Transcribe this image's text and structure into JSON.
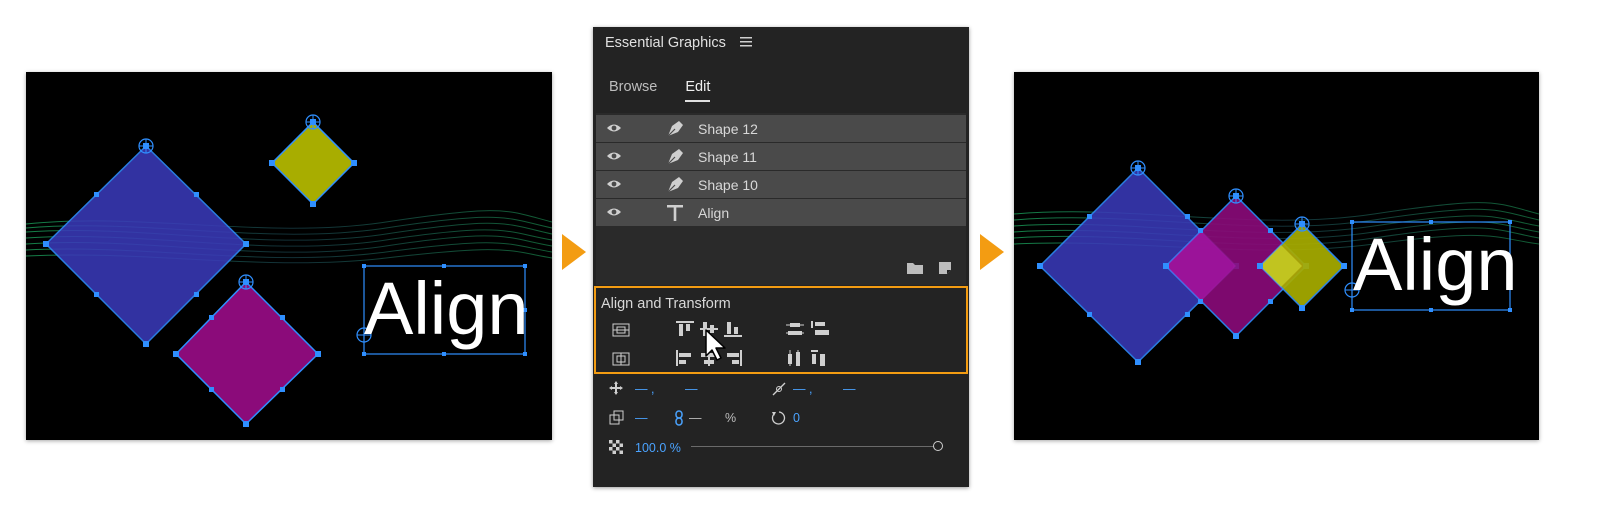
{
  "panel": {
    "title": "Essential Graphics",
    "tabs": [
      {
        "label": "Browse",
        "active": false
      },
      {
        "label": "Edit",
        "active": true
      }
    ],
    "layers": [
      {
        "name": "Shape 12",
        "type": "pen-icon"
      },
      {
        "name": "Shape 11",
        "type": "pen-icon"
      },
      {
        "name": "Shape 10",
        "type": "pen-icon"
      },
      {
        "name": "Align",
        "type": "text-tool-icon"
      }
    ],
    "align_section": {
      "title": "Align and Transform"
    },
    "properties": {
      "position_x": "— ,",
      "position_y": "—",
      "anchor_x": "— ,",
      "anchor_y": "—",
      "scale": "—",
      "scale_linked": "—",
      "percent": "%",
      "rotation": "0",
      "opacity": "100.0 %"
    }
  },
  "canvas_before": {
    "text": "Align"
  },
  "canvas_after": {
    "text": "Align"
  },
  "colors": {
    "highlight": "#f39c12",
    "blue_shape": "#3a3ab8",
    "magenta_shape": "#8b0b7a",
    "olive_shape": "#a8ad00",
    "selection": "#2f8fff",
    "panel_bg": "#232323",
    "layer_row": "#4a4a4a",
    "value_blue": "#4aa3ff"
  }
}
